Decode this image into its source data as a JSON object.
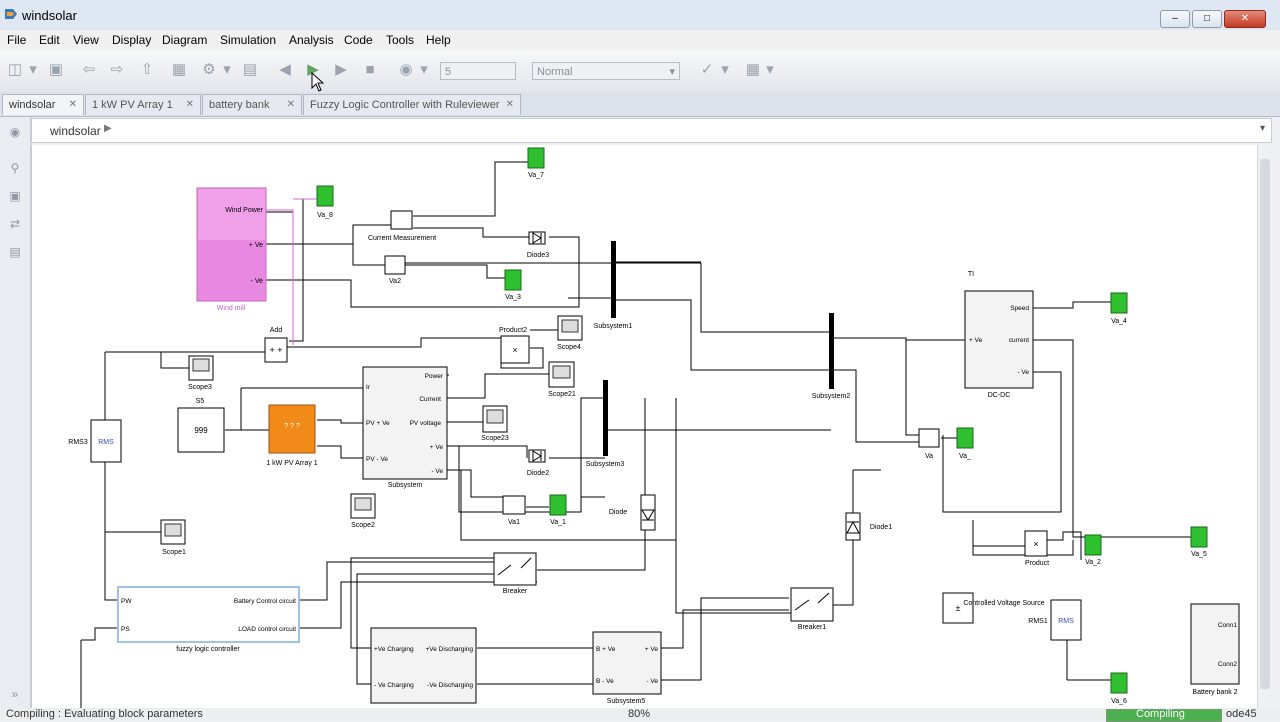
{
  "window": {
    "title": "windsolar"
  },
  "menu": [
    "File",
    "Edit",
    "View",
    "Display",
    "Diagram",
    "Simulation",
    "Analysis",
    "Code",
    "Tools",
    "Help"
  ],
  "toolbar": {
    "stop_time": "5",
    "sim_mode": "Normal"
  },
  "tabs": [
    "windsolar",
    "1 kW  PV Array 1",
    "battery bank",
    "Fuzzy Logic  Controller  with Ruleviewer"
  ],
  "breadcrumb": "windsolar",
  "status": {
    "text": "Compiling : Evaluating block parameters",
    "zoom": "80%",
    "progress_label": "Compiling",
    "solver": "ode45"
  },
  "blocks": {
    "va_8": "Va_8",
    "va_7": "Va_7",
    "va_3": "Va_3",
    "va_4": "Va_4",
    "va_": "Va_",
    "va_1": "Va_1",
    "va_2": "Va_2",
    "va_5": "Va_5",
    "va_6": "Va_6",
    "wind_power": "Wind Power",
    "wind_plus": "+ Ve",
    "wind_minus": "- Ve",
    "wind_mill": "Wind mill",
    "current_measurement": "Current Measurement",
    "va2": "Va2",
    "diode3": "Diode3",
    "diode2": "Diode2",
    "diode": "Diode",
    "diode1": "Diode1",
    "subsystem1": "Subsystem1",
    "subsystem2": "Subsystem2",
    "subsystem3": "Subsystem3",
    "subsystem": "Subsystem",
    "subsystem5": "Subsystem5",
    "product2": "Product2",
    "product": "Product",
    "scope4": "Scope4",
    "scope3": "Scope3",
    "scope21": "Scope21",
    "scope23": "Scope23",
    "scope2": "Scope2",
    "scope1": "Scope1",
    "add": "Add",
    "s5": "S5",
    "s5_value": "999",
    "pv_array": "1 kW  PV Array 1",
    "pv_marks": "? ? ?",
    "rms3": "RMS3",
    "rms": "RMS",
    "rms1": "RMS1",
    "sub_ir": "Ir",
    "sub_pv_plus": "PV + Ve",
    "sub_pv_minus": "PV - Ve",
    "sub_power": "Power",
    "sub_current": "Current",
    "sub_pv_voltage": "PV voltage",
    "sub_plus": "+ Ve",
    "sub_minus": "- Ve",
    "va": "Va",
    "va1": "Va1",
    "ti": "TI",
    "dcdc": "DC-DC",
    "dcdc_ve": "+ Ve",
    "dcdc_speed": "Speed",
    "dcdc_current": "current",
    "dcdc_minus": "- Ve",
    "breaker": "Breaker",
    "breaker1": "Breaker1",
    "cvs": "Controlled Voltage Source",
    "flc": "fuzzy logic controller",
    "flc_pw": "PW",
    "flc_ps": "PS",
    "flc_battery": "Battery  Control circuit",
    "flc_load": "LOAD  control circuit",
    "chg_plus": "+Ve Charging",
    "chg_minus": "- Ve  Charging",
    "dis_plus": "+Ve Discharging",
    "dis_minus": "-Ve Discharging",
    "s5b_plus": "B + Ve",
    "s5b_minus": "B - Ve",
    "s5_ve_plus": "+ Ve",
    "s5_ve_minus": "- Ve",
    "bb2": "Battery bank 2",
    "conn1": "Conn1",
    "conn2": "Conn2"
  },
  "colors": {
    "scope_green": "#2ec02e",
    "wind_pink": "#f0a0e8",
    "pv_orange": "#f28a1a",
    "flc_blue": "#9fc3e8"
  }
}
